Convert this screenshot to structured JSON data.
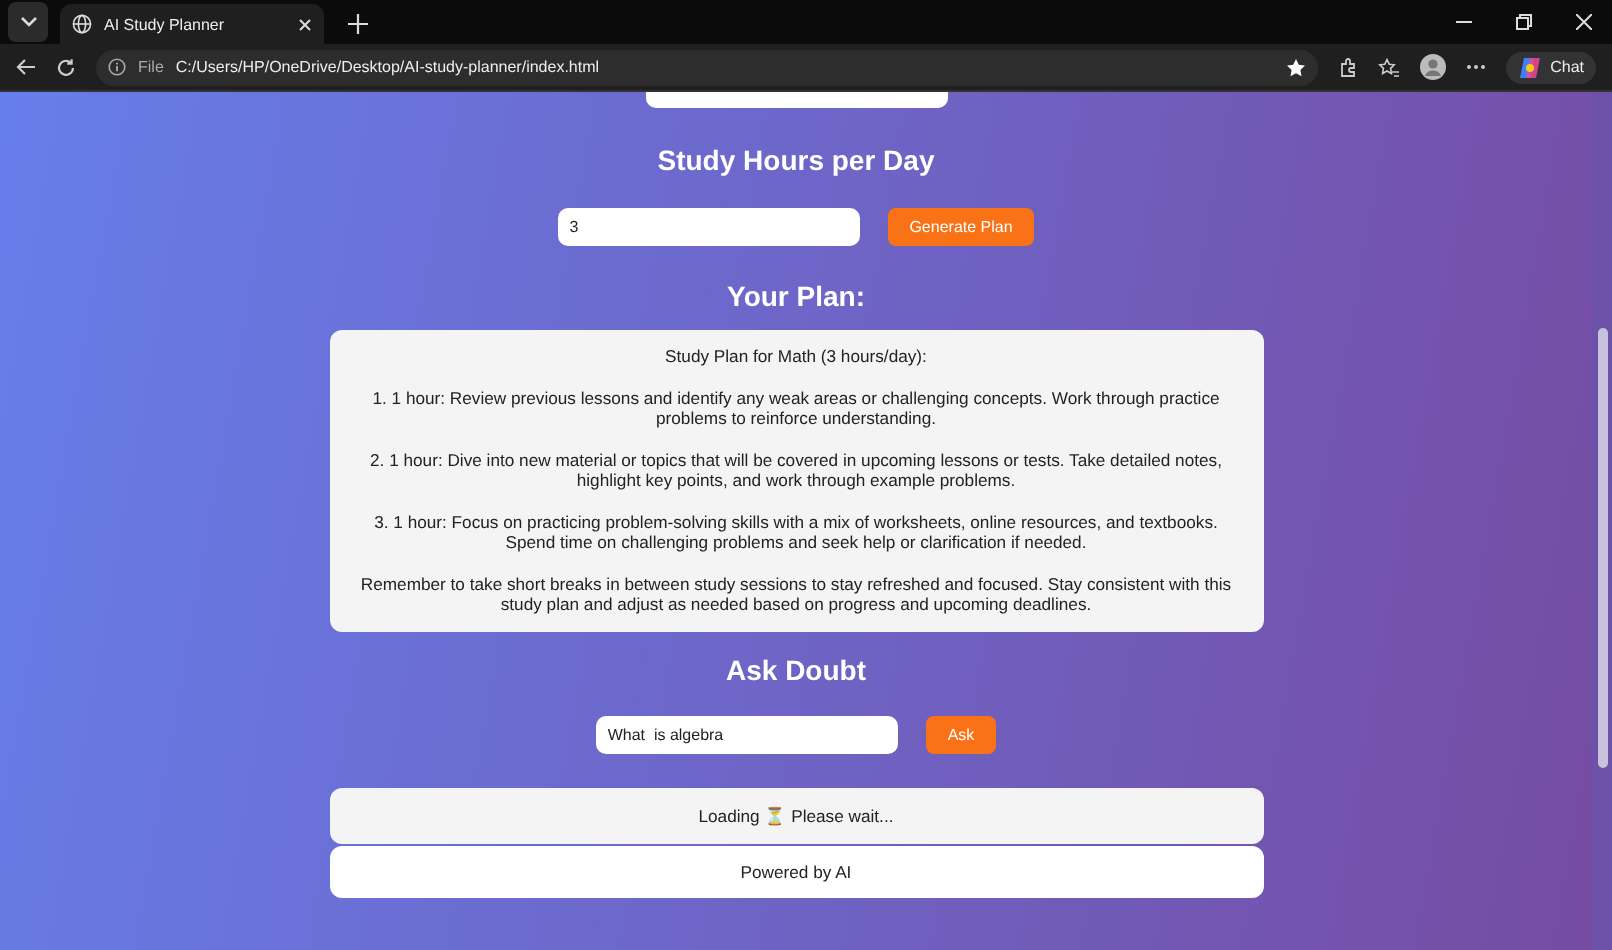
{
  "browser": {
    "tab_title": "AI Study Planner",
    "address_scheme": "File",
    "address": "C:/Users/HP/OneDrive/Desktop/AI-study-planner/index.html",
    "copilot_label": "Chat"
  },
  "hours_section": {
    "heading": "Study Hours per Day",
    "value": "3",
    "button": "Generate Plan"
  },
  "plan": {
    "heading": "Your Plan:",
    "paragraphs": [
      "Study Plan for Math (3 hours/day):",
      "1. 1 hour: Review previous lessons and identify any weak areas or challenging concepts. Work through practice problems to reinforce understanding.",
      "2. 1 hour: Dive into new material or topics that will be covered in upcoming lessons or tests. Take detailed notes, highlight key points, and work through example problems.",
      "3. 1 hour: Focus on practicing problem-solving skills with a mix of worksheets, online resources, and textbooks. Spend time on challenging problems and seek help or clarification if needed.",
      "Remember to take short breaks in between study sessions to stay refreshed and focused. Stay consistent with this study plan and adjust as needed based on progress and upcoming deadlines."
    ]
  },
  "doubt_section": {
    "heading": "Ask Doubt",
    "value": "What  is algebra",
    "button": "Ask"
  },
  "answer": "Loading ⏳ Please wait...",
  "footer": "Powered by AI"
}
